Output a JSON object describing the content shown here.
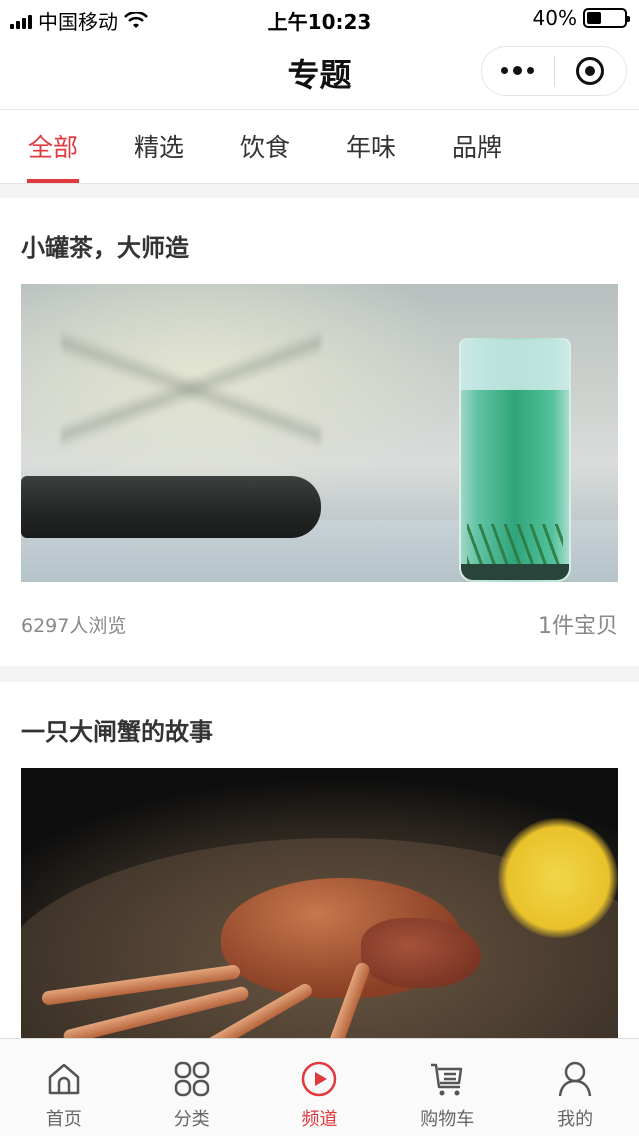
{
  "status_bar": {
    "carrier": "中国移动",
    "time": "上午10:23",
    "battery_percent": "40%",
    "battery_level": 0.4
  },
  "nav": {
    "title": "专题"
  },
  "tabs": [
    {
      "label": "全部",
      "active": true
    },
    {
      "label": "精选",
      "active": false
    },
    {
      "label": "饮食",
      "active": false
    },
    {
      "label": "年味",
      "active": false
    },
    {
      "label": "品牌",
      "active": false
    }
  ],
  "cards": [
    {
      "title": "小罐茶，大师造",
      "views": "6297人浏览",
      "items": "1件宝贝",
      "image": "tea-glass-image"
    },
    {
      "title": "一只大闸蟹的故事",
      "image": "crab-image"
    }
  ],
  "tabbar": [
    {
      "label": "首页",
      "icon": "home-icon",
      "active": false
    },
    {
      "label": "分类",
      "icon": "category-icon",
      "active": false
    },
    {
      "label": "频道",
      "icon": "play-icon",
      "active": true
    },
    {
      "label": "购物车",
      "icon": "cart-icon",
      "active": false
    },
    {
      "label": "我的",
      "icon": "user-icon",
      "active": false
    }
  ],
  "colors": {
    "accent": "#e0393e",
    "text": "#333333",
    "muted": "#888888"
  }
}
